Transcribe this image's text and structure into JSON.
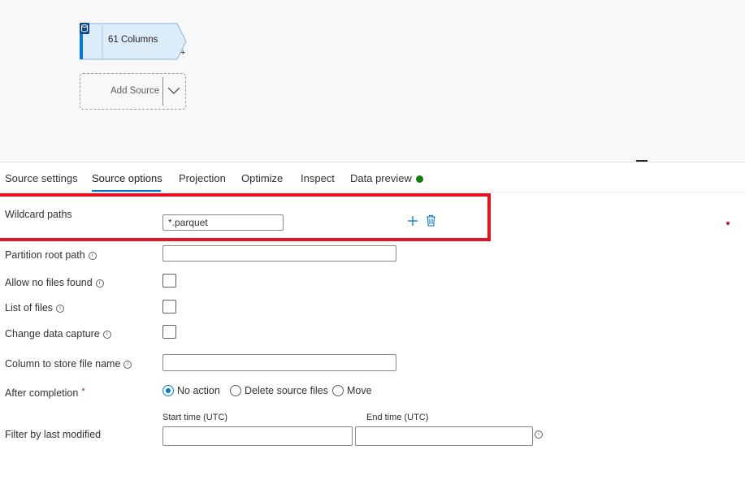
{
  "canvas": {
    "source_node": {
      "label": "61 Columns",
      "icon": "database-icon",
      "plus": "+"
    },
    "add_source": {
      "label": "Add Source",
      "icon": "chevron-down-icon"
    }
  },
  "tabs": [
    {
      "label": "Source settings"
    },
    {
      "label": "Source options",
      "active": true
    },
    {
      "label": "Projection"
    },
    {
      "label": "Optimize"
    },
    {
      "label": "Inspect"
    },
    {
      "label": "Data preview",
      "status_color": "#107c10"
    }
  ],
  "form": {
    "wildcard_paths": {
      "label": "Wildcard paths",
      "value": "*.parquet",
      "add_icon": "plus-icon",
      "delete_icon": "trash-icon"
    },
    "partition_root_path": {
      "label": "Partition root path",
      "value": ""
    },
    "allow_no_files_found": {
      "label": "Allow no files found",
      "checked": false
    },
    "list_of_files": {
      "label": "List of files",
      "checked": false
    },
    "change_data_capture": {
      "label": "Change data capture",
      "checked": false
    },
    "column_to_store_file_name": {
      "label": "Column to store file name",
      "value": ""
    },
    "after_completion": {
      "label": "After completion",
      "required_mark": "*",
      "options": [
        "No action",
        "Delete source files",
        "Move"
      ],
      "selected": "No action"
    },
    "filter_by_last_modified": {
      "label": "Filter by last modified",
      "start_label": "Start time (UTC)",
      "end_label": "End time (UTC)",
      "start_value": "",
      "end_value": ""
    },
    "info_glyph": "i"
  },
  "colors": {
    "accent": "#0078d4",
    "highlight": "#e81123",
    "success": "#107c10"
  }
}
